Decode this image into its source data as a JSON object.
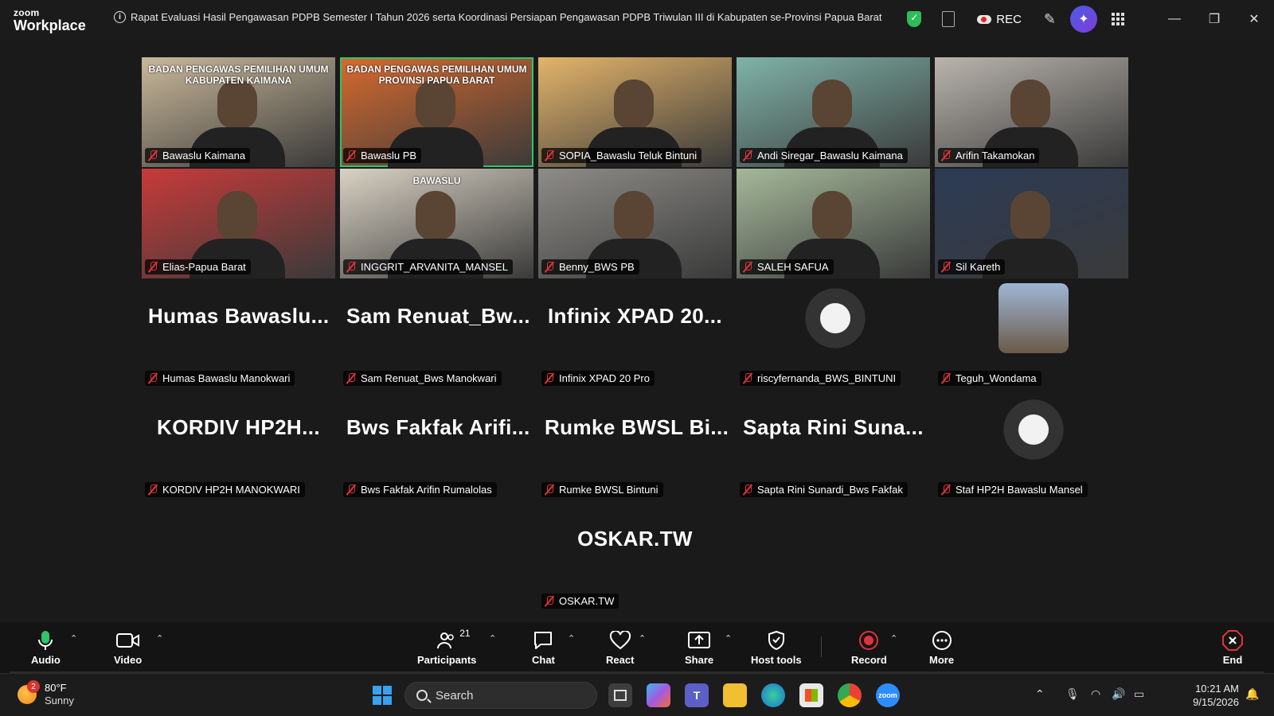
{
  "app": {
    "brand_top": "zoom",
    "brand_bottom": "Workplace"
  },
  "meeting": {
    "title": "Rapat Evaluasi Hasil Pengawasan PDPB Semester I Tahun 2026 serta Koordinasi Persiapan Pengawasan PDPB Triwulan III di Kabupaten se-Provinsi Papua Barat"
  },
  "titlebar": {
    "rec_label": "REC"
  },
  "participants_video": [
    {
      "name": "Bawaslu Kaimana",
      "color": "#c9b89a",
      "active": false,
      "scene_text": "BADAN PENGAWAS PEMILIHAN UMUM KABUPATEN KAIMANA"
    },
    {
      "name": "Bawaslu PB",
      "color": "#d86a2e",
      "active": true,
      "scene_text": "BADAN PENGAWAS PEMILIHAN UMUM PROVINSI PAPUA BARAT"
    },
    {
      "name": "SOPIA_Bawaslu Teluk Bintuni",
      "color": "#e3b46a",
      "active": false
    },
    {
      "name": "Andi Siregar_Bawaslu Kaimana",
      "color": "#7fb3a8",
      "active": false
    },
    {
      "name": "Arifin Takamokan",
      "color": "#b9b4ad",
      "active": false
    },
    {
      "name": "Elias-Papua Barat",
      "color": "#c93a3a",
      "active": false
    },
    {
      "name": "INGGRIT_ARVANITA_MANSEL",
      "color": "#d9d2c4",
      "active": false,
      "scene_text": "BAWASLU"
    },
    {
      "name": "Benny_BWS PB",
      "color": "#8d8c88",
      "active": false
    },
    {
      "name": "SALEH SAFUA",
      "color": "#a5b89a",
      "active": false
    },
    {
      "name": "Sil Kareth",
      "color": "#2c3b55",
      "active": false
    }
  ],
  "participants_text": [
    {
      "big": "Humas  Bawaslu...",
      "name": "Humas Bawaslu Manokwari"
    },
    {
      "big": "Sam  Renuat_Bw...",
      "name": "Sam Renuat_Bws Manokwari"
    },
    {
      "big": "Infinix XPAD 20...",
      "name": "Infinix XPAD 20 Pro"
    },
    {
      "big": "",
      "name": "riscyfernanda_BWS_BINTUNI",
      "avatar": "cartoon-owls"
    },
    {
      "big": "",
      "name": "Teguh_Wondama",
      "avatar": "photo"
    },
    {
      "big": "KORDIV  HP2H...",
      "name": "KORDIV HP2H MANOKWARI"
    },
    {
      "big": "Bws Fakfak Arifi...",
      "name": "Bws Fakfak Arifin Rumalolas"
    },
    {
      "big": "Rumke  BWSL  Bi...",
      "name": "Rumke BWSL Bintuni"
    },
    {
      "big": "Sapta Rini Suna...",
      "name": "Sapta Rini Sunardi_Bws Fakfak"
    },
    {
      "big": "",
      "name": "Staf HP2H Bawaslu Mansel",
      "avatar": "cartoon-owl"
    },
    {
      "big": "OSKAR.TW",
      "name": "OSKAR.TW"
    }
  ],
  "toolbar": {
    "audio": "Audio",
    "video": "Video",
    "participants": "Participants",
    "participants_count": "21",
    "chat": "Chat",
    "react": "React",
    "share": "Share",
    "host_tools": "Host tools",
    "record": "Record",
    "more": "More",
    "end": "End"
  },
  "taskbar": {
    "weather_temp": "80°F",
    "weather_desc": "Sunny",
    "weather_badge": "2",
    "search_label": "Search",
    "time": "10:21 AM",
    "date": "9/15/2026"
  },
  "colors": {
    "active_speaker": "#2ec46b",
    "muted": "#e0333a",
    "record": "#e0333a",
    "end": "#e0333a"
  }
}
